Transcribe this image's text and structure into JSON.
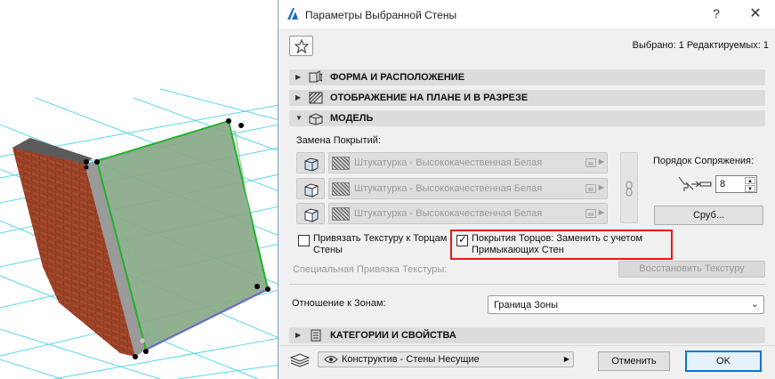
{
  "dialog": {
    "title": "Параметры Выбранной Стены",
    "help_label": "?",
    "close_label": "✕",
    "selected_status": "Выбрано: 1 Редактируемых: 1"
  },
  "sections": {
    "shape": "ФОРМА И РАСПОЛОЖЕНИЕ",
    "display": "ОТОБРАЖЕНИЕ НА ПЛАНЕ И В РАЗРЕЗЕ",
    "model": "МОДЕЛЬ",
    "categories": "КАТЕГОРИИ И СВОЙСТВА"
  },
  "model": {
    "surfaces_label": "Замена Покрытий:",
    "surfaces": [
      "Штукатурка - Высококачественная Белая",
      "Штукатурка - Высококачественная Белая",
      "Штукатурка - Высококачественная Белая"
    ],
    "join_order_label": "Порядок Сопряжения:",
    "join_order_value": "8",
    "rubble_button": "Сруб...",
    "bind_texture_label": "Привязать Текстуру к Торцам Стены",
    "bind_texture_checked": false,
    "cover_ends_label": "Покрытия Торцов: Заменить с учетом Примыкающих Стен",
    "cover_ends_checked": true,
    "special_binding_label": "Специальная Привязка Текстуры:",
    "restore_texture_button": "Восстановить Текстуру"
  },
  "zones": {
    "label": "Отношение к Зонам:",
    "value": "Граница Зоны"
  },
  "footer": {
    "layer": "Конструктив - Стены Несущие",
    "cancel": "Отменить",
    "ok": "OK"
  },
  "colors": {
    "highlight": "#e3181e",
    "ok_border": "#0078d7",
    "grid": "#3fd0ec",
    "wall_selected": "#8aa88a",
    "selection_outline": "#22b22a"
  },
  "icons": {
    "favorite": "star-icon",
    "shape": "wall-geometry-icon",
    "display": "plan-section-icon",
    "model": "model-box-icon",
    "categories": "list-icon",
    "link": "chain-link-icon",
    "layer": "layers-icon",
    "visibility": "eye-icon"
  }
}
